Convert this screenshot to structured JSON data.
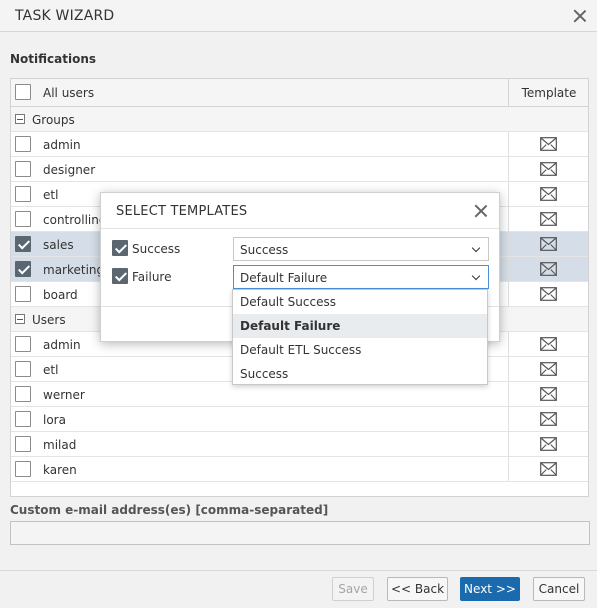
{
  "dialog": {
    "title": "TASK WIZARD"
  },
  "notifications": {
    "section_label": "Notifications",
    "header": {
      "all_users_label": "All users",
      "template_label": "Template",
      "all_checked": false
    },
    "groups_header": "Groups",
    "groups": [
      {
        "name": "admin",
        "checked": false
      },
      {
        "name": "designer",
        "checked": false
      },
      {
        "name": "etl",
        "checked": false
      },
      {
        "name": "controlling",
        "checked": false
      },
      {
        "name": "sales",
        "checked": true
      },
      {
        "name": "marketing",
        "checked": true
      },
      {
        "name": "board",
        "checked": false
      }
    ],
    "users_header": "Users",
    "users": [
      {
        "name": "admin",
        "checked": false
      },
      {
        "name": "etl",
        "checked": false
      },
      {
        "name": "werner",
        "checked": false
      },
      {
        "name": "lora",
        "checked": false
      },
      {
        "name": "milad",
        "checked": false
      },
      {
        "name": "karen",
        "checked": false
      }
    ],
    "template_icon": "mail-template-icon"
  },
  "custom_email": {
    "label": "Custom e-mail address(es) [comma-separated]",
    "value": "",
    "placeholder": ""
  },
  "footer": {
    "save_label": "Save",
    "back_label": "<< Back",
    "next_label": "Next >>",
    "cancel_label": "Cancel"
  },
  "select_templates": {
    "title": "SELECT TEMPLATES",
    "success": {
      "label": "Success",
      "checked": true,
      "value": "Success"
    },
    "failure": {
      "label": "Failure",
      "checked": true,
      "value": "Default Failure"
    },
    "options": [
      {
        "label": "Default Success",
        "active": false
      },
      {
        "label": "Default Failure",
        "active": true
      },
      {
        "label": "Default ETL Success",
        "active": false
      },
      {
        "label": "Success",
        "active": false
      }
    ]
  },
  "colors": {
    "primary": "#1b6aad",
    "selected_row": "#d5dee8",
    "checkbox_checked": "#5b6770"
  }
}
